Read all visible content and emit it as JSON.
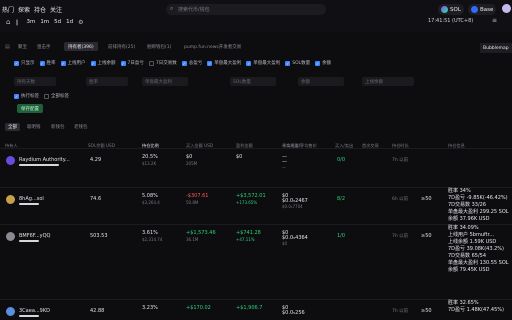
{
  "nav": {
    "items": [
      "热门",
      "探索",
      "持仓",
      "关注"
    ],
    "timeframes": [
      "3m",
      "1m",
      "5d",
      "1d"
    ]
  },
  "search": {
    "placeholder": "搜索代币/钱包"
  },
  "chain": {
    "label": "SOL",
    "network": "Base"
  },
  "clock": {
    "time": "17:41:51 (UTC+8)"
  },
  "tabs": [
    "聚宝",
    "狙击手",
    "持有者(396)",
    "前排持有(25)",
    "捆绑钱包(1)",
    "pump.fun.news开发者交易"
  ],
  "bubblemap": {
    "label": "Bubblemap"
  },
  "filters": {
    "row1": [
      {
        "label": "只显示",
        "checked": true
      },
      {
        "label": "胜率",
        "checked": true
      },
      {
        "label": "上线用户",
        "checked": true
      },
      {
        "label": "上线余额",
        "checked": true
      },
      {
        "label": "7日盈亏",
        "checked": true
      },
      {
        "label": "7日交易数",
        "checked": false
      },
      {
        "label": "总盈亏",
        "checked": true
      },
      {
        "label": "单盘最大盈利",
        "checked": true
      },
      {
        "label": "单盘最大盈利",
        "checked": true
      },
      {
        "label": "SOL数量",
        "checked": true
      },
      {
        "label": "余额",
        "checked": true
      }
    ],
    "inputs": [
      "持有天数",
      "胜率",
      "单盘最大盈利",
      "SOL数量",
      "余额",
      "上线余额"
    ],
    "row2": [
      {
        "label": "执行标签",
        "checked": true
      },
      {
        "label": "全部标签",
        "checked": false
      }
    ]
  },
  "save_label": "保存配置",
  "subtabs": [
    "全部",
    "聪明钱",
    "新钱包",
    "老钱包"
  ],
  "headers": [
    "持有人",
    "SOL余额 USD",
    "持仓比例",
    "买入金额 USD",
    "盈利金额",
    "未实现盈亏",
    "平均成本/平均售价",
    "买入/卖出",
    "首次交易",
    "持仓时长",
    "持仓信息"
  ],
  "rows": [
    {
      "name": "Raydium Authority...",
      "sol": "4.29",
      "pct": "20.5%",
      "pct_sub": "$13.2K",
      "bought": "$0",
      "bought_sub": "205M",
      "profit": "$0",
      "unreal": "—",
      "avg": "—",
      "avg_sub": "—",
      "trades": "0/0",
      "time": "7h 以前",
      "avatar_color": "#6a4be0",
      "info": []
    },
    {
      "name": "8hAg...sol",
      "sol": "74.6",
      "pct": "5.08%",
      "pct_sub": "$3,264.4",
      "bought": "-$307.61",
      "bought_sub": "50.8M",
      "profit": "+$3,572.01",
      "profit_sub": "+173.65%",
      "unreal": "$0",
      "avg": "$0.0₅2467",
      "avg_sub": "$0.0₅7704",
      "trades": "8/2",
      "time": "6h 以前",
      "hold": "≥50",
      "avatar_color": "#c7a14a",
      "info": [
        "胜率 34%",
        "7D盈亏 -9.85K(-46.42%)",
        "7D交易数 33/26",
        "单盘最大盈利 299.25 SOL",
        "余额 37.96K USD"
      ]
    },
    {
      "name": "BMF6F...yQQ",
      "sol": "503.53",
      "pct": "3.61%",
      "pct_sub": "$2,314.74",
      "bought": "+$1,573.46",
      "bought_sub": "36.1M",
      "profit": "+$741.28",
      "profit_sub": "+47.11%",
      "unreal": "$0",
      "avg": "$0.0₅4364",
      "avg_sub": "$0",
      "trades": "1/0",
      "time": "7h 以前",
      "hold": "≥50",
      "avatar_color": "#8a8a93",
      "info": [
        "胜率 34.09%",
        "上线用户 5bmuftr...",
        "上线余额 1.59K USD",
        "7D盈亏 39.08K(43.2%)",
        "7D交易数 65/54",
        "单盘最大盈利 130.55 SOL",
        "余额 79.45K USD"
      ]
    },
    {
      "name": "3Caea...9KD",
      "sol": "42.88",
      "pct": "3.23%",
      "pct_sub": "",
      "bought": "+$170.02",
      "bought_sub": "",
      "profit": "+$1,906.7",
      "profit_sub": "",
      "unreal": "$0",
      "avg": "$0.0₅256",
      "avg_sub": "",
      "trades": "",
      "time": "7h 以前",
      "hold": "≥50",
      "avatar_color": "#5a8fe0",
      "info": [
        "胜率 32.65%",
        "7D盈亏 1.48K(47.45%)"
      ]
    }
  ]
}
